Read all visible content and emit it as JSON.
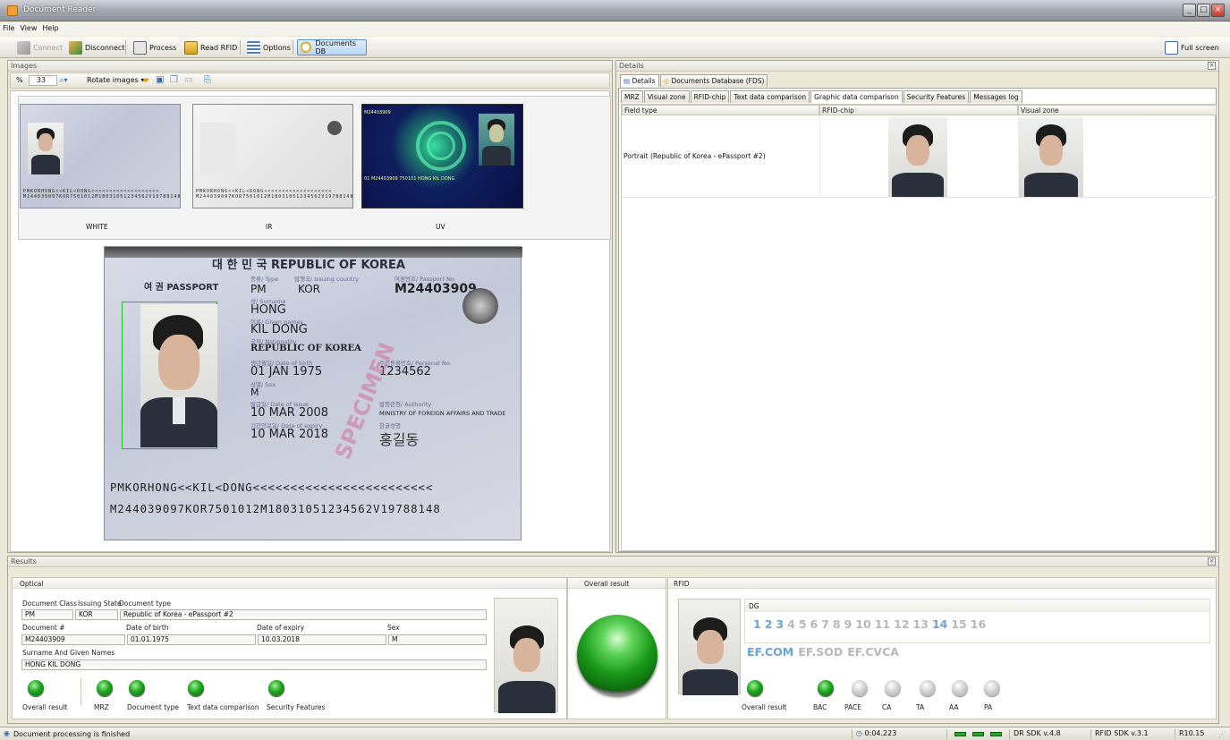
{
  "window": {
    "title": "Document Reader"
  },
  "menu": [
    "File",
    "View",
    "Help"
  ],
  "toolbar": {
    "connect": "Connect",
    "disconnect": "Disconnect",
    "process": "Process",
    "read_rfid": "Read RFID",
    "options": "Options",
    "documents_db": "Documents DB",
    "full_screen": "Full screen"
  },
  "images_panel": {
    "title": "Images",
    "zoom_unit": "%",
    "zoom_value": "33",
    "rotate_label": "Rotate images",
    "thumbs": [
      "WHITE",
      "IR",
      "UV"
    ]
  },
  "passport": {
    "header": "대 한 민 국   REPUBLIC OF KOREA",
    "doc_label": "여 권  PASSPORT",
    "type_label": "종류/ Type",
    "type_value": "PM",
    "country_label": "발행국/ Issuing country",
    "country_value": "KOR",
    "passport_no_label": "여권번호/ Passport No.",
    "passport_no": "M24403909",
    "surname_label": "성/ Surname",
    "surname": "HONG",
    "given_label": "이름/ Given names",
    "given": "KIL DONG",
    "nationality_label": "국적/ Nationality",
    "nationality": "REPUBLIC OF KOREA",
    "dob_label": "생년월일/ Date of birth",
    "dob": "01 JAN 1975",
    "personal_no_label": "주민등록번호/ Personal No.",
    "personal_no": "1234562",
    "sex_label": "성별/ Sex",
    "sex": "M",
    "issue_label": "발급일/ Date of issue",
    "issue": "10 MAR 2008",
    "authority_label": "발행관청/ Authority",
    "authority": "MINISTRY OF FOREIGN AFFAIRS AND TRADE",
    "expiry_label": "기간만료일/ Date of expiry",
    "expiry": "10 MAR 2018",
    "signature_label": "한글성명",
    "signature": "홍길동",
    "specimen": "SPECIMEN",
    "mrz1": "PMKORHONG<<KIL<DONG<<<<<<<<<<<<<<<<<<<<<<<<",
    "mrz2": "M244039097KOR7501012M18031051234562V19788148",
    "uv_text": "01 M24403909 750101 HONG KIL DONG"
  },
  "details": {
    "title": "Details",
    "top_tabs": [
      "Details",
      "Documents Database (FDS)"
    ],
    "sub_tabs": [
      "MRZ",
      "Visual zone",
      "RFID-chip",
      "Text data comparison",
      "Graphic data comparison",
      "Security Features",
      "Messages log"
    ],
    "columns": [
      "Field type",
      "RFID-chip",
      "Visual zone"
    ],
    "row_field": "Portrait (Republic of Korea - ePassport #2)"
  },
  "results": {
    "title": "Results",
    "optical": {
      "title": "Optical",
      "doc_class_label": "Document Class",
      "issuing_state_label": "Issuing State",
      "doc_type_label": "Document type",
      "doc_class": "PM",
      "issuing_state": "KOR",
      "doc_type": "Republic of Korea - ePassport #2",
      "doc_no_label": "Document #",
      "dob_label": "Date of birth",
      "expiry_label": "Date of expiry",
      "sex_label": "Sex",
      "doc_no": "M24403909",
      "dob": "01.01.1975",
      "expiry": "10.03.2018",
      "sex": "M",
      "name_label": "Surname And Given Names",
      "name": "HONG KIL DONG",
      "leds": [
        "Overall result",
        "MRZ",
        "Document type",
        "Text data comparison",
        "Security Features"
      ]
    },
    "overall": {
      "title": "Overall result"
    },
    "rfid": {
      "title": "RFID",
      "dg_label": "DG",
      "dg": [
        "1",
        "2",
        "3",
        "4",
        "5",
        "6",
        "7",
        "8",
        "9",
        "10",
        "11",
        "12",
        "13",
        "14",
        "15",
        "16"
      ],
      "dg_active": [
        true,
        true,
        true,
        false,
        false,
        false,
        false,
        false,
        false,
        false,
        false,
        false,
        false,
        true,
        false,
        false
      ],
      "ef": [
        "EF.COM",
        "EF.SOD",
        "EF.CVCA"
      ],
      "ef_active": [
        true,
        false,
        false
      ],
      "leds": [
        "Overall result",
        "BAC",
        "PACE",
        "CA",
        "TA",
        "AA",
        "PA"
      ],
      "led_states": [
        "green",
        "green",
        "grey",
        "grey",
        "grey",
        "grey",
        "grey"
      ]
    }
  },
  "statusbar": {
    "message": "Document processing is finished",
    "time": "0:04.223",
    "dr_sdk": "DR SDK v.4.8",
    "rfid_sdk": "RFID SDK v.3.1",
    "release": "R10.15"
  },
  "colors": {
    "accent_blue": "#5b8fc7",
    "dg_active": "#6aa3d8",
    "dg_inactive": "#b8b8b8",
    "led_green": "#1ea51e"
  }
}
